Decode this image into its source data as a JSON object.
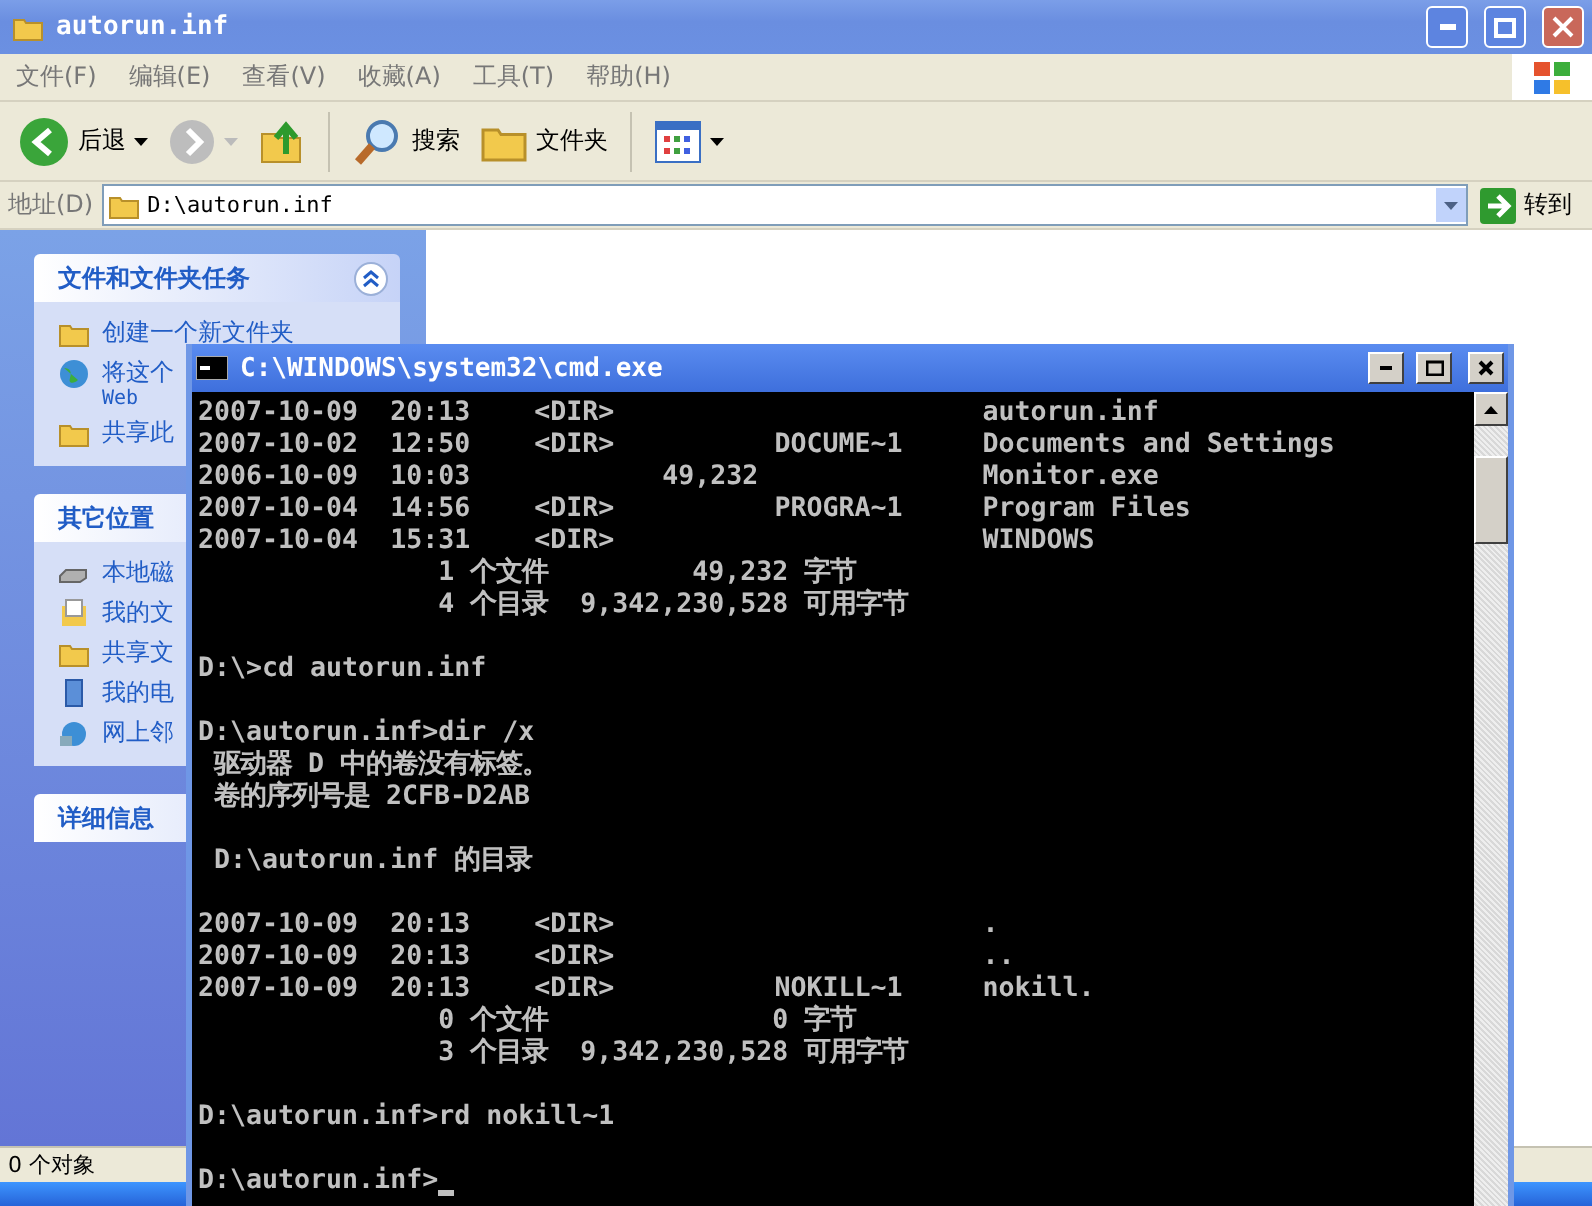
{
  "explorer": {
    "title": "autorun.inf",
    "menu": [
      "文件(F)",
      "编辑(E)",
      "查看(V)",
      "收藏(A)",
      "工具(T)",
      "帮助(H)"
    ],
    "toolbar": [
      {
        "kind": "back",
        "label": "后退",
        "disabled": false
      },
      {
        "kind": "forward",
        "disabled": true
      },
      {
        "kind": "up"
      },
      {
        "kind": "separator"
      },
      {
        "kind": "search",
        "label": "搜索"
      },
      {
        "kind": "folders",
        "label": "文件夹"
      },
      {
        "kind": "separator"
      },
      {
        "kind": "views"
      }
    ],
    "address": {
      "label": "地址(D)",
      "value": "D:\\autorun.inf",
      "go": "转到"
    },
    "sidebar": [
      {
        "title": "文件和文件夹任务",
        "expanded": true,
        "items": [
          {
            "kind": "new-folder",
            "text": "创建一个新文件夹"
          },
          {
            "kind": "web",
            "text": "将这个",
            "subtext": "Web"
          },
          {
            "kind": "share",
            "text": "共享此"
          }
        ]
      },
      {
        "title": "其它位置",
        "items": [
          {
            "kind": "drive",
            "text": "本地磁"
          },
          {
            "kind": "documents",
            "text": "我的文"
          },
          {
            "kind": "folder",
            "text": "共享文"
          },
          {
            "kind": "computer",
            "text": "我的电"
          },
          {
            "kind": "network",
            "text": "网上邻"
          }
        ]
      },
      {
        "title": "详细信息"
      }
    ],
    "status_bar": "0 个对象"
  },
  "console": {
    "title": "C:\\WINDOWS\\system32\\cmd.exe",
    "lines": [
      {
        "kind": "text",
        "text": "2007-10-09  20:13    <DIR>                       autorun.inf"
      },
      {
        "kind": "text",
        "text": "2007-10-02  12:50    <DIR>          DOCUME~1     Documents and Settings"
      },
      {
        "kind": "text",
        "text": "2006-10-09  10:03            49,232              Monitor.exe"
      },
      {
        "kind": "text",
        "text": "2007-10-04  14:56    <DIR>          PROGRA~1     Program Files"
      },
      {
        "kind": "text",
        "text": "2007-10-04  15:31    <DIR>                       WINDOWS"
      },
      {
        "kind": "text",
        "text": "               1 个文件         49,232 字节"
      },
      {
        "kind": "text",
        "text": "               4 个目录  9,342,230,528 可用字节"
      },
      {
        "kind": "blank"
      },
      {
        "kind": "text",
        "text": "D:\\>cd autorun.inf"
      },
      {
        "kind": "blank"
      },
      {
        "kind": "text",
        "text": "D:\\autorun.inf>dir /x"
      },
      {
        "kind": "text",
        "text": " 驱动器 D 中的卷没有标签。"
      },
      {
        "kind": "text",
        "text": " 卷的序列号是 2CFB-D2AB"
      },
      {
        "kind": "blank"
      },
      {
        "kind": "text",
        "text": " D:\\autorun.inf 的目录"
      },
      {
        "kind": "blank"
      },
      {
        "kind": "text",
        "text": "2007-10-09  20:13    <DIR>                       ."
      },
      {
        "kind": "text",
        "text": "2007-10-09  20:13    <DIR>                       .."
      },
      {
        "kind": "text",
        "text": "2007-10-09  20:13    <DIR>          NOKILL~1     nokill."
      },
      {
        "kind": "text",
        "text": "               0 个文件              0 字节"
      },
      {
        "kind": "text",
        "text": "               3 个目录  9,342,230,528 可用字节"
      },
      {
        "kind": "blank"
      },
      {
        "kind": "text",
        "text": "D:\\autorun.inf>rd nokill~1"
      },
      {
        "kind": "blank"
      },
      {
        "kind": "text",
        "text": "D:\\autorun.inf>",
        "cursor": true
      }
    ]
  }
}
